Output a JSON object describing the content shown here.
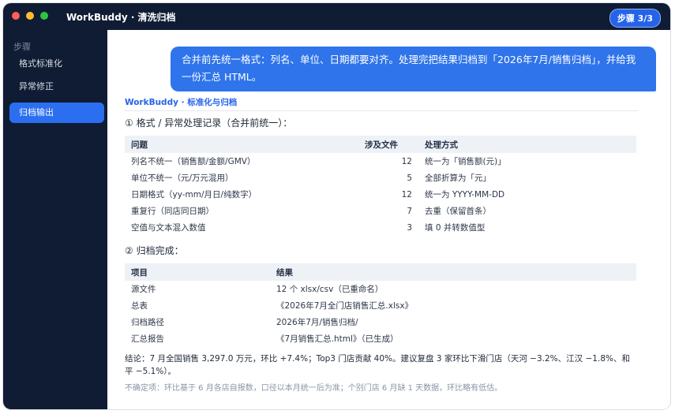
{
  "window": {
    "app_title": "WorkBuddy · 清洗归档",
    "step_badge": "步骤 3/3"
  },
  "sidebar": {
    "section_label": "步骤",
    "items": [
      {
        "label": "格式标准化"
      },
      {
        "label": "异常修正"
      },
      {
        "label": "归档输出"
      }
    ]
  },
  "chat": {
    "user_message": "合并前先统一格式：列名、单位、日期都要对齐。处理完把结果归档到「2026年7月/销售归档」，并给我一份汇总 HTML。"
  },
  "response": {
    "brand": "WorkBuddy · 标准化与归档",
    "section1_title": "① 格式 / 异常处理记录（合并前统一）：",
    "table1": {
      "headers": [
        "问题",
        "涉及文件",
        "处理方式"
      ],
      "rows": [
        [
          "列名不统一（销售额/金额/GMV）",
          "12",
          "统一为「销售额(元)」"
        ],
        [
          "单位不统一（元/万元混用）",
          "5",
          "全部折算为「元」"
        ],
        [
          "日期格式（yy-mm/月日/纯数字）",
          "12",
          "统一为 YYYY-MM-DD"
        ],
        [
          "重复行（同店同日期）",
          "7",
          "去重（保留首条）"
        ],
        [
          "空值与文本混入数值",
          "3",
          "填 0 并转数值型"
        ]
      ]
    },
    "section2_title": "② 归档完成：",
    "table2": {
      "headers": [
        "项目",
        "结果"
      ],
      "rows": [
        [
          "源文件",
          "12 个 xlsx/csv（已重命名）"
        ],
        [
          "总表",
          "《2026年7月全门店销售汇总.xlsx》"
        ],
        [
          "归档路径",
          "2026年7月/销售归档/"
        ],
        [
          "汇总报告",
          "《7月销售汇总.html》（已生成）"
        ]
      ]
    },
    "conclusion": "结论：7 月全国销售 3,297.0 万元，环比 +7.4%；Top3 门店贡献 40%。建议复盘 3 家环比下滑门店（天河 −3.2%、江汉 −1.8%、和平 −5.1%）。",
    "uncertain": "不确定项：环比基于 6 月各店自报数，口径以本月统一后为准；个别门店 6 月缺 1 天数据，环比略有低估。"
  }
}
